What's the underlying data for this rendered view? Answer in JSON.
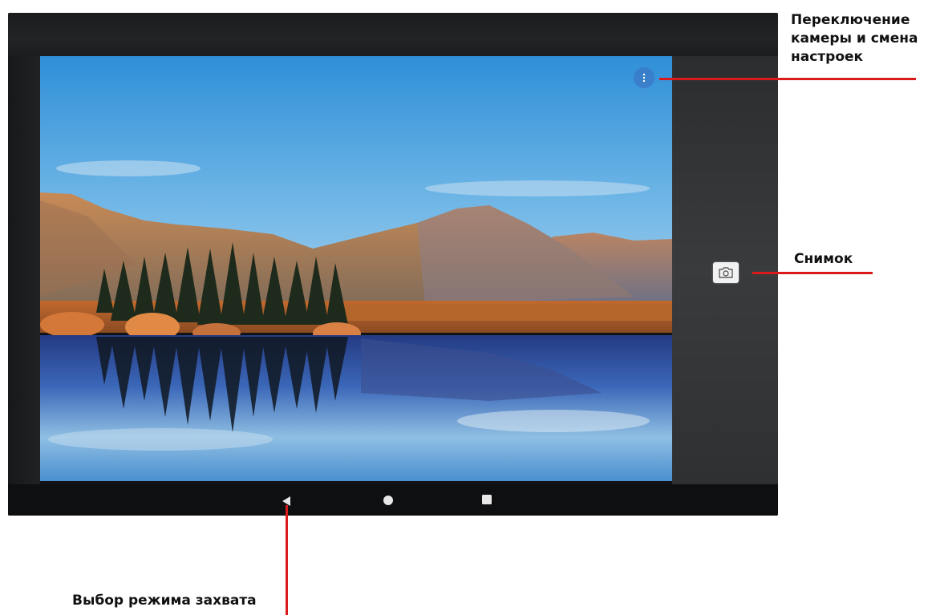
{
  "annotations": {
    "settings_callout": "Переключение камеры и смена настроек",
    "shutter_callout": "Снимок",
    "mode_callout": "Выбор режима захвата"
  },
  "camera_app": {
    "overflow_menu_icon": "more-vert-icon",
    "shutter_icon": "camera-icon",
    "preview_subject": "mountain lake landscape"
  },
  "navigation_bar": {
    "back_icon": "back-triangle-icon",
    "home_icon": "home-circle-icon",
    "recents_icon": "recents-square-icon"
  },
  "colors": {
    "callout_line": "#d91b1b",
    "device_frame": "#121314",
    "side_panel": "#333537"
  }
}
